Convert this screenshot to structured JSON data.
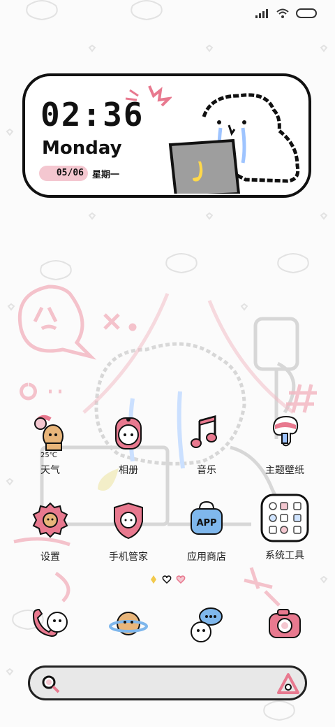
{
  "clock": {
    "time": "02:36",
    "day": "Monday",
    "date": "05/06",
    "weekday": "星期一"
  },
  "apps": [
    {
      "label": "天气",
      "icon": "weather-icon",
      "sub": "25℃"
    },
    {
      "label": "相册",
      "icon": "gallery-icon"
    },
    {
      "label": "音乐",
      "icon": "music-icon"
    },
    {
      "label": "主题壁纸",
      "icon": "theme-icon"
    },
    {
      "label": "设置",
      "icon": "settings-icon"
    },
    {
      "label": "手机管家",
      "icon": "security-icon"
    },
    {
      "label": "应用商店",
      "icon": "app-store-icon",
      "badge": "APP"
    },
    {
      "label": "系统工具",
      "icon": "system-tools-folder-icon"
    }
  ],
  "dock": [
    {
      "icon": "phone-icon"
    },
    {
      "icon": "browser-planet-icon"
    },
    {
      "icon": "messages-icon"
    },
    {
      "icon": "camera-icon"
    }
  ],
  "colors": {
    "accent_pink": "#e8798f",
    "outline": "#111111",
    "search_bg": "#e8e8e8"
  }
}
